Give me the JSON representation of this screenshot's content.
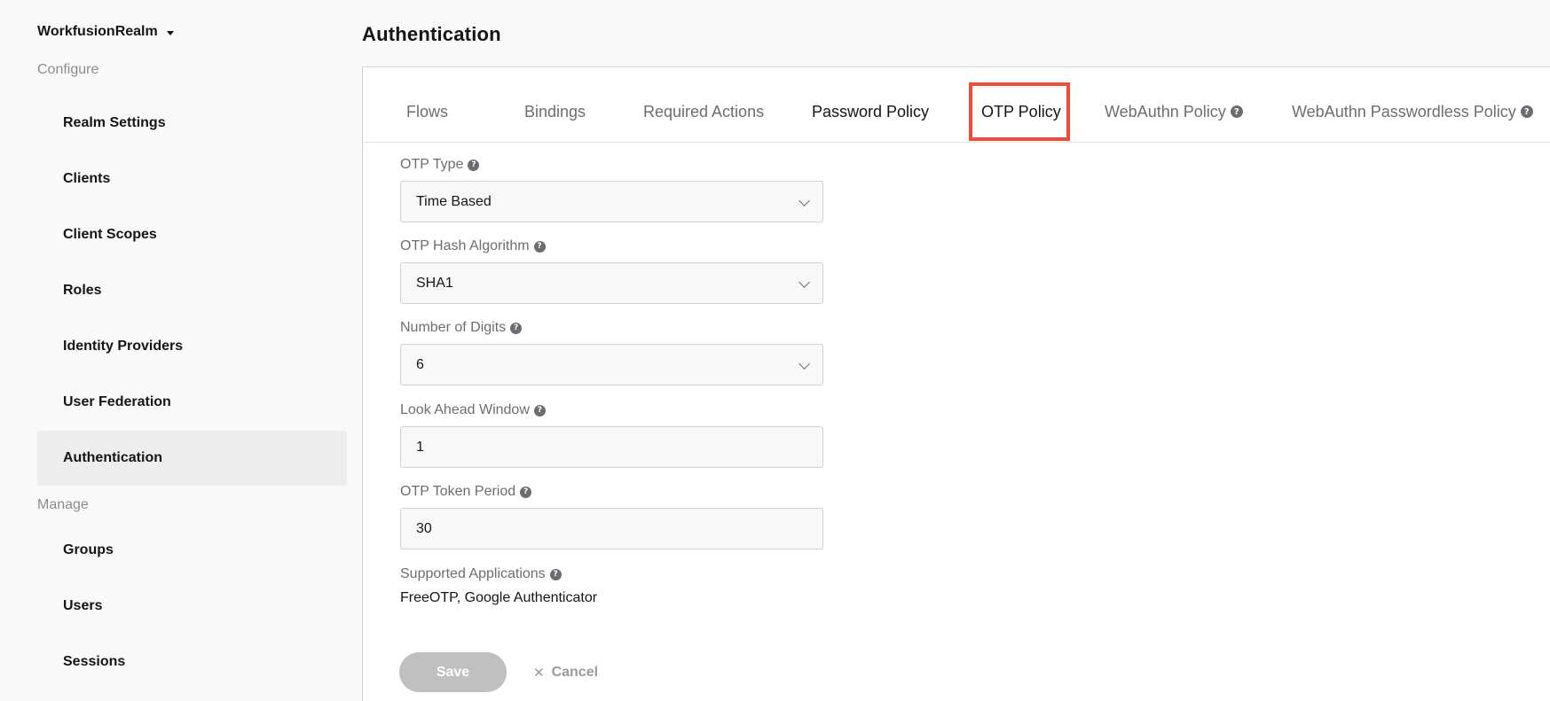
{
  "sidebar": {
    "realm_name": "WorkfusionRealm",
    "configure_label": "Configure",
    "configure_items": [
      {
        "label": "Realm Settings"
      },
      {
        "label": "Clients"
      },
      {
        "label": "Client Scopes"
      },
      {
        "label": "Roles"
      },
      {
        "label": "Identity Providers"
      },
      {
        "label": "User Federation"
      },
      {
        "label": "Authentication",
        "active": true
      }
    ],
    "manage_label": "Manage",
    "manage_items": [
      {
        "label": "Groups"
      },
      {
        "label": "Users"
      },
      {
        "label": "Sessions"
      }
    ]
  },
  "main": {
    "title": "Authentication",
    "tabs": [
      {
        "label": "Flows"
      },
      {
        "label": "Bindings"
      },
      {
        "label": "Required Actions"
      },
      {
        "label": "Password Policy"
      },
      {
        "label": "OTP Policy",
        "selected": true
      },
      {
        "label": "WebAuthn Policy",
        "help": true
      },
      {
        "label": "WebAuthn Passwordless Policy",
        "help": true
      }
    ],
    "form": {
      "otp_type": {
        "label": "OTP Type",
        "value": "Time Based"
      },
      "otp_hash": {
        "label": "OTP Hash Algorithm",
        "value": "SHA1"
      },
      "digits": {
        "label": "Number of Digits",
        "value": "6"
      },
      "look_ahead": {
        "label": "Look Ahead Window",
        "value": "1"
      },
      "token_period": {
        "label": "OTP Token Period",
        "value": "30"
      },
      "supported_apps": {
        "label": "Supported Applications",
        "value": "FreeOTP, Google Authenticator"
      }
    },
    "actions": {
      "save_label": "Save",
      "cancel_label": "Cancel"
    }
  },
  "colors": {
    "highlight_border": "#ee4b3a",
    "active_nav_bg": "#ededed",
    "save_disabled": "#c0c0c0"
  },
  "icons": {
    "help": "question-circle-icon",
    "select": "chevron-down-icon",
    "realm_caret": "caret-down-icon",
    "cancel": "close-icon"
  }
}
